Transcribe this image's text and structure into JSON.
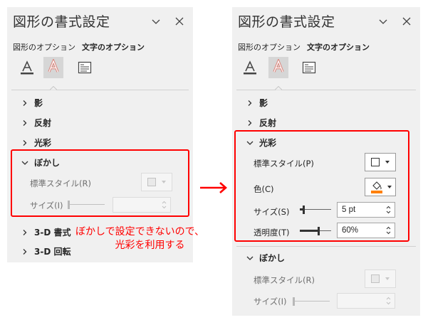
{
  "arrow_color": "#ff0000",
  "highlight_color": "#ff0000",
  "annotation": {
    "line1": "ぼかしで設定できないので、",
    "line2": "光彩を利用する"
  },
  "left_panel": {
    "title": "図形の書式設定",
    "header_icons": [
      "chevron-down-icon",
      "close-icon"
    ],
    "tabs": [
      {
        "label": "図形のオプション",
        "active": false
      },
      {
        "label": "文字のオプション",
        "active": true
      }
    ],
    "categories": [
      "text-fill-outline-icon",
      "text-effects-icon",
      "textbox-layout-icon"
    ],
    "selected_category": "text-effects-icon",
    "sections": [
      {
        "label": "影",
        "expanded": false
      },
      {
        "label": "反射",
        "expanded": false
      },
      {
        "label": "光彩",
        "expanded": false
      },
      {
        "label": "ぼかし",
        "expanded": true
      },
      {
        "label": "3-D 書式",
        "expanded": false
      },
      {
        "label": "3-D 回転",
        "expanded": false
      }
    ],
    "blur": {
      "preset_label": "標準スタイル(R)",
      "size_label": "サイズ(I)",
      "size_value": "",
      "disabled": true
    }
  },
  "right_panel": {
    "title": "図形の書式設定",
    "header_icons": [
      "chevron-down-icon",
      "close-icon"
    ],
    "tabs": [
      {
        "label": "図形のオプション",
        "active": false
      },
      {
        "label": "文字のオプション",
        "active": true
      }
    ],
    "categories": [
      "text-fill-outline-icon",
      "text-effects-icon",
      "textbox-layout-icon"
    ],
    "selected_category": "text-effects-icon",
    "sections": [
      {
        "label": "影",
        "expanded": false
      },
      {
        "label": "反射",
        "expanded": false
      },
      {
        "label": "光彩",
        "expanded": true
      },
      {
        "label": "ぼかし",
        "expanded": true
      }
    ],
    "glow": {
      "preset_label": "標準スタイル(P)",
      "color_label": "色(C)",
      "color_value": "#ff8000",
      "size_label": "サイズ(S)",
      "size_value": "5 pt",
      "size_level": 0.1,
      "transparency_label": "透明度(T)",
      "transparency_value": "60%",
      "transparency_level": 0.6
    },
    "blur": {
      "preset_label": "標準スタイル(R)",
      "size_label": "サイズ(I)",
      "size_value": "",
      "disabled": true
    }
  }
}
